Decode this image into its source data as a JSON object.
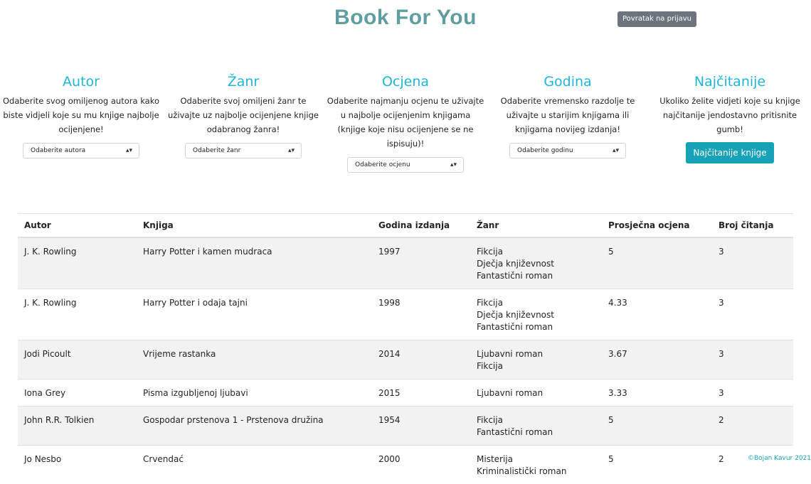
{
  "header": {
    "title": "Book For You",
    "back_label": "Povratak na prijavu"
  },
  "filters": [
    {
      "title": "Autor",
      "description": "Odaberite svog omiljenog autora kako biste vidjeli koje su mu knjige najbolje ocijenjene!",
      "select_value": "Odaberite autora"
    },
    {
      "title": "Žanr",
      "description": "Odaberite svoj omiljeni žanr te uživajte uz najbolje ocijenjene knjige odabranog žanra!",
      "select_value": "Odaberite žanr"
    },
    {
      "title": "Ocjena",
      "description": "Odaberite najmanju ocjenu te uživajte u najbolje ocijenjenim knjigama (knjige koje nisu ocijenjene se ne ispisuju)!",
      "select_value": "Odaberite ocjenu"
    },
    {
      "title": "Godina",
      "description": "Odaberite vremensko razdolje te uživajte u starijim knjigama ili knjigama novijeg izdanja!",
      "select_value": "Odaberite godinu"
    },
    {
      "title": "Najčitanije",
      "description": "Ukoliko želite vidjeti koje su knjige najčitanije jendostavno pritisnite gumb!",
      "button_label": "Najčitanije knjige"
    }
  ],
  "table": {
    "headers": [
      "Autor",
      "Knjiga",
      "Godina izdanja",
      "Žanr",
      "Prosječna ocjena",
      "Broj čitanja"
    ],
    "rows": [
      {
        "author": "J. K. Rowling",
        "book": "Harry Potter i kamen mudraca",
        "year": "1997",
        "genres": [
          "Fikcija",
          "Dječja književnost",
          "Fantastični roman"
        ],
        "rating": "5",
        "reads": "3"
      },
      {
        "author": "J. K. Rowling",
        "book": "Harry Potter i odaja tajni",
        "year": "1998",
        "genres": [
          "Fikcija",
          "Dječja književnost",
          "Fantastični roman"
        ],
        "rating": "4.33",
        "reads": "3"
      },
      {
        "author": "Jodi Picoult",
        "book": "Vrijeme rastanka",
        "year": "2014",
        "genres": [
          "Ljubavni roman",
          "Fikcija"
        ],
        "rating": "3.67",
        "reads": "3"
      },
      {
        "author": "Iona Grey",
        "book": "Pisma izgubljenoj ljubavi",
        "year": "2015",
        "genres": [
          "Ljubavni roman"
        ],
        "rating": "3.33",
        "reads": "3"
      },
      {
        "author": "John R.R. Tolkien",
        "book": "Gospodar prstenova 1 - Prstenova družina",
        "year": "1954",
        "genres": [
          "Fikcija",
          "Fantastični roman"
        ],
        "rating": "5",
        "reads": "2"
      },
      {
        "author": "Jo Nesbo",
        "book": "Crvendać",
        "year": "2000",
        "genres": [
          "Misterija",
          "Kriminalistički roman"
        ],
        "rating": "5",
        "reads": "2"
      }
    ]
  },
  "footer": {
    "text": "©Bojan Kavur 2021"
  }
}
